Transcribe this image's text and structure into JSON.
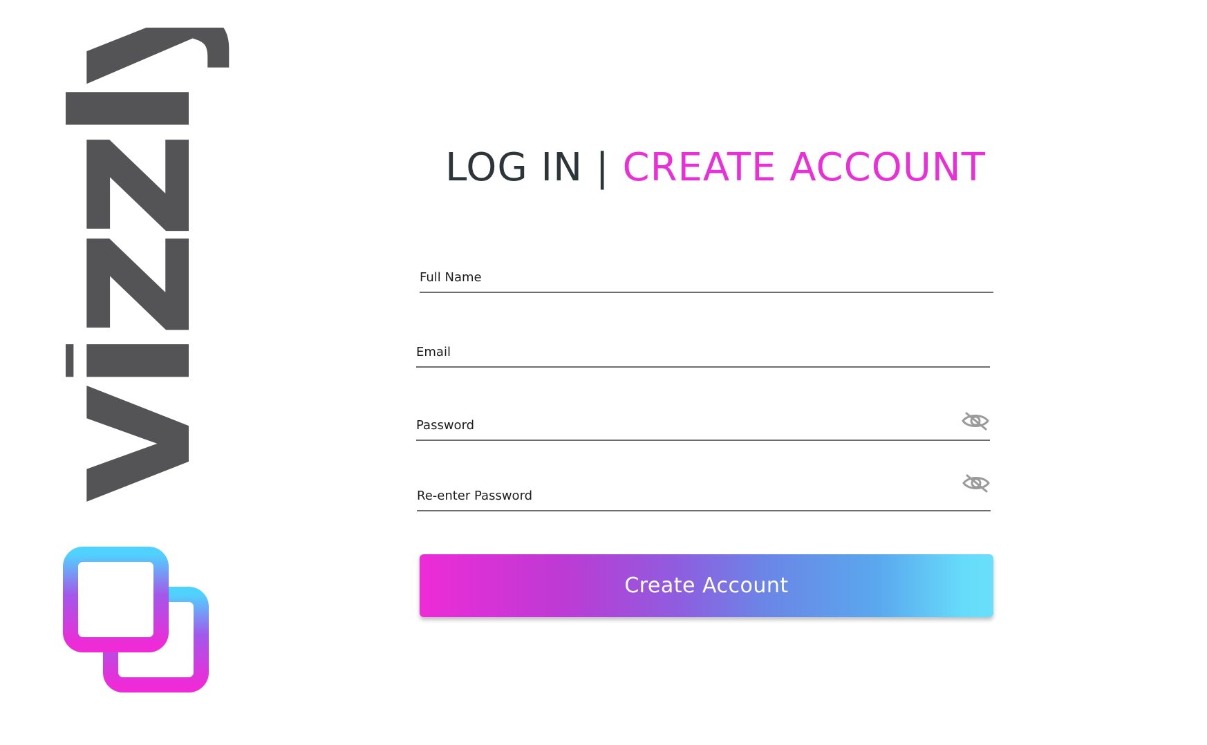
{
  "brand": {
    "wordmark": "vizzly",
    "logo_colors": [
      "#50b8ff",
      "#a955e8",
      "#ee2bd7"
    ],
    "wordmark_color": "#545456"
  },
  "header": {
    "login_tab": "LOG IN",
    "separator": "|",
    "create_tab": "CREATE ACCOUNT",
    "active_color": "#e930d6"
  },
  "form": {
    "full_name": {
      "label": "Full Name",
      "value": ""
    },
    "email": {
      "label": "Email",
      "value": ""
    },
    "password": {
      "label": "Password",
      "value": "",
      "toggle_icon": "eye-off-icon"
    },
    "reenter_password": {
      "label": "Re-enter Password",
      "value": "",
      "toggle_icon": "eye-off-icon"
    },
    "submit_label": "Create Account"
  }
}
